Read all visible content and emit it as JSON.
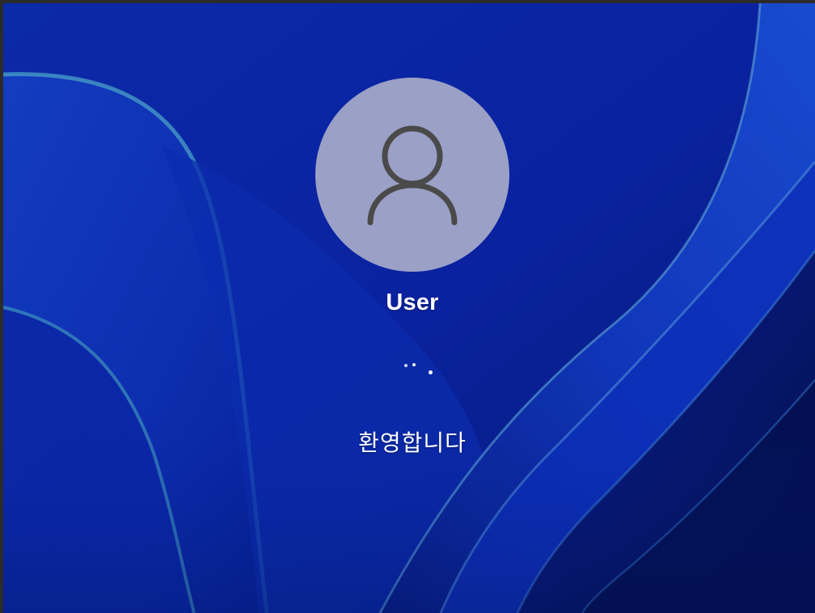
{
  "login": {
    "user_name": "User",
    "status_text": "환영합니다",
    "avatar_icon": "user-silhouette-icon",
    "loading_icon": "loading-dots-icon"
  },
  "colors": {
    "avatar_background": "#9aa0c6",
    "avatar_glyph": "#4a4a4a",
    "text": "#ffffff",
    "wallpaper_base": "#0a1f9a"
  }
}
